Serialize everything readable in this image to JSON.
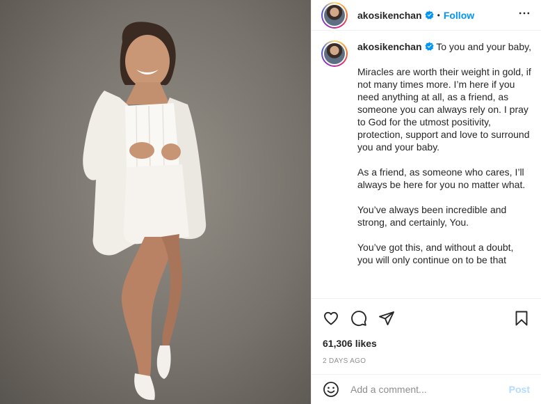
{
  "post": {
    "author": "akosikenchan",
    "follow_label": "Follow",
    "separator": "•",
    "caption_user": "akosikenchan",
    "caption": " To you and your baby,\n\nMiracles are worth their weight in gold, if not many times more. I’m here if you need anything at all, as a friend, as someone you can always rely on. I pray to God for the utmost positivity, protection, support and love to surround you and your baby.\n\nAs a friend, as someone who cares, I’ll always be here for you no matter what.\n\nYou’ve always been incredible and strong, and certainly, You.\n\nYou’ve got this, and without a doubt, you will only continue on to be that",
    "likes": "61,306 likes",
    "time": "2 DAYS AGO"
  },
  "comment": {
    "placeholder": "Add a comment...",
    "post_label": "Post"
  },
  "icons": {
    "more": "more-options-icon",
    "verified": "verified-badge-icon",
    "like": "heart-icon",
    "comment": "comment-icon",
    "share": "share-icon",
    "save": "bookmark-icon",
    "emoji": "emoji-icon"
  },
  "colors": {
    "accent": "#0095f6",
    "post_disabled": "#b3dbff",
    "muted": "#8e8e8e"
  }
}
